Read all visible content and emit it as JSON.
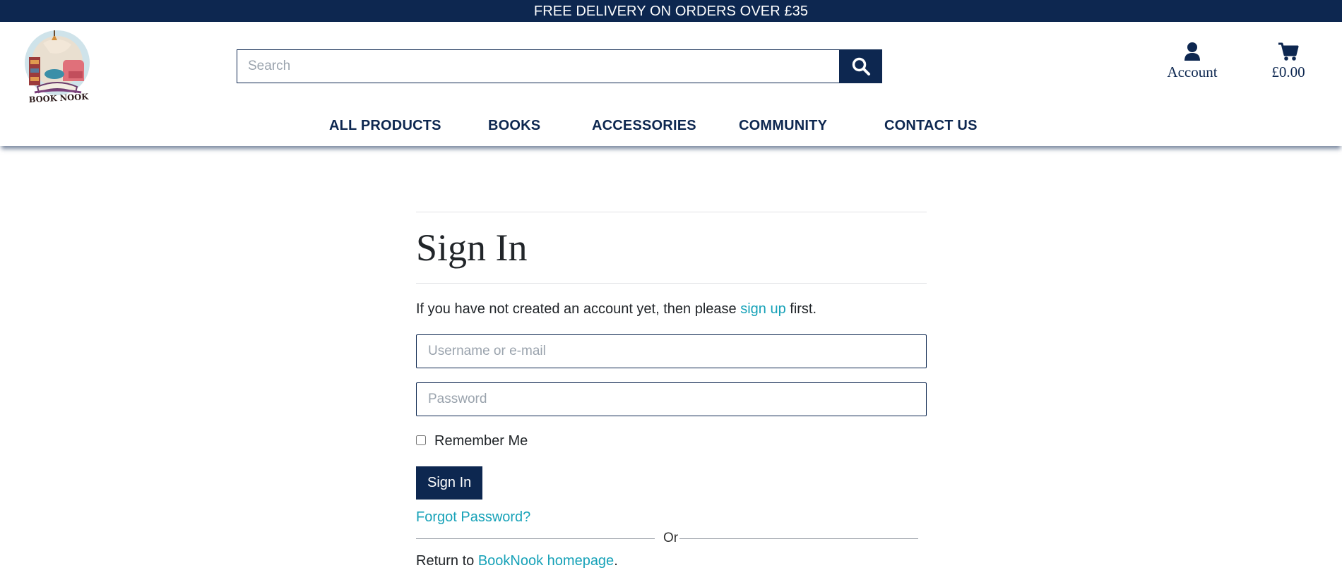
{
  "topbar": {
    "text": "FREE DELIVERY ON ORDERS OVER £35"
  },
  "logo": {
    "text": "BOOK NOOK"
  },
  "search": {
    "placeholder": "Search"
  },
  "header": {
    "account_label": "Account",
    "cart_total": "£0.00"
  },
  "nav": {
    "items": [
      {
        "label": "ALL PRODUCTS"
      },
      {
        "label": "BOOKS"
      },
      {
        "label": "ACCESSORIES"
      },
      {
        "label": "COMMUNITY"
      },
      {
        "label": "CONTACT US"
      }
    ]
  },
  "signin": {
    "title": "Sign In",
    "intro_before": "If you have not created an account yet, then please ",
    "intro_link": "sign up",
    "intro_after": " first.",
    "username_placeholder": "Username or e-mail",
    "password_placeholder": "Password",
    "remember_label": "Remember Me",
    "submit_label": "Sign In",
    "forgot_label": "Forgot Password?",
    "or_label": "Or",
    "return_before": "Return to ",
    "return_link": "BookNook homepage",
    "return_after": "."
  },
  "colors": {
    "brand": "#0d2750",
    "link": "#17a2b8"
  },
  "icons": [
    "search-icon",
    "user-icon",
    "cart-icon",
    "book-nook-logo"
  ]
}
